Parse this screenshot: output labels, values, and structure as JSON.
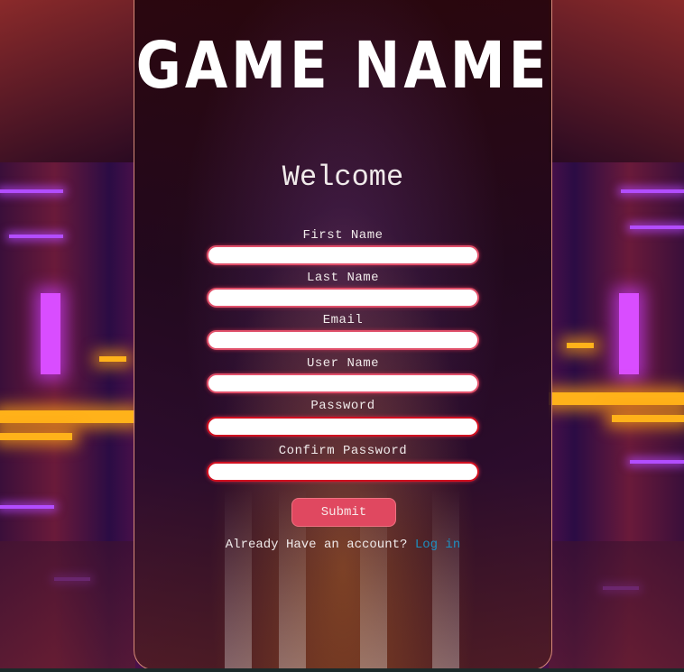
{
  "app": {
    "title": "GAME NAME"
  },
  "form": {
    "heading": "Welcome",
    "fields": [
      {
        "label": "First Name",
        "value": ""
      },
      {
        "label": "Last Name",
        "value": ""
      },
      {
        "label": "Email",
        "value": ""
      },
      {
        "label": "User Name",
        "value": ""
      },
      {
        "label": "Password",
        "value": ""
      },
      {
        "label": "Confirm Password",
        "value": ""
      }
    ],
    "submit_label": "Submit",
    "login_prompt": "Already Have an account?",
    "login_link": "Log in"
  },
  "colors": {
    "accent": "#e04860",
    "link": "#1e8fbf",
    "input_border": "#e0506a",
    "password_border": "#d01020"
  }
}
